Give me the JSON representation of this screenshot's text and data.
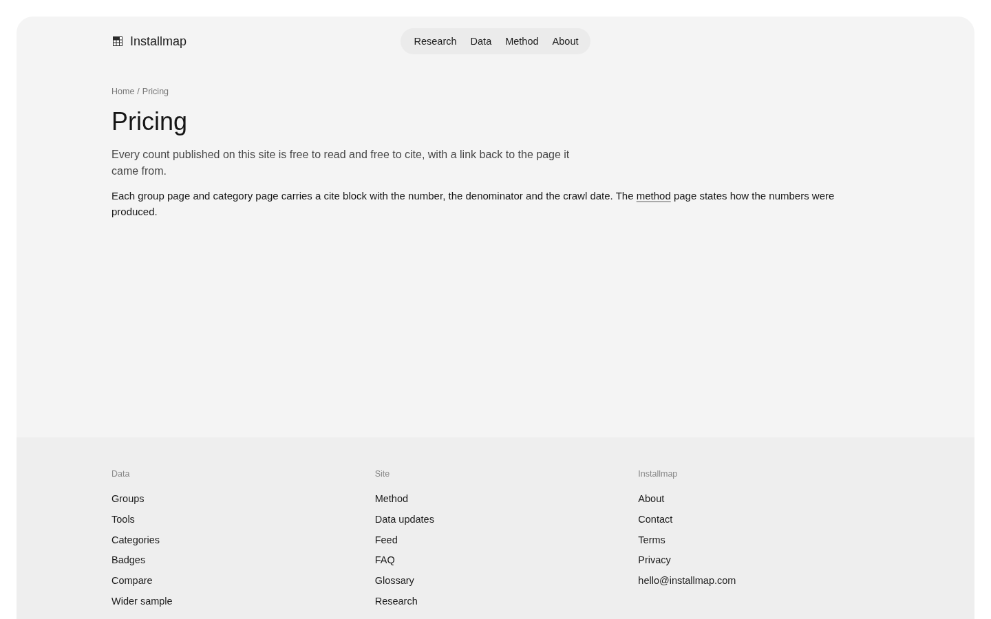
{
  "header": {
    "brand": "Installmap",
    "nav": [
      {
        "label": "Research"
      },
      {
        "label": "Data"
      },
      {
        "label": "Method"
      },
      {
        "label": "About"
      }
    ]
  },
  "breadcrumb": {
    "items": [
      "Home",
      "Pricing"
    ],
    "separator": "/"
  },
  "title": "Pricing",
  "lead": "Every count published on this site is free to read and free to cite, with a link back to the page it came from.",
  "body": [
    {
      "kind": "text",
      "text": "Each group page and category page carries a cite block with the number, the denominator and the crawl date. The "
    },
    {
      "kind": "link",
      "text": "method"
    },
    {
      "kind": "text",
      "text": " page states how the numbers were produced."
    }
  ],
  "footer": {
    "columns": [
      {
        "heading": "Data",
        "links": [
          "Groups",
          "Tools",
          "Categories",
          "Badges",
          "Compare",
          "Wider sample"
        ]
      },
      {
        "heading": "Site",
        "links": [
          "Method",
          "Data updates",
          "Feed",
          "FAQ",
          "Glossary",
          "Research"
        ]
      },
      {
        "heading": "Installmap",
        "links": [
          "About",
          "Contact",
          "Terms",
          "Privacy",
          "hello@installmap.com"
        ]
      }
    ]
  }
}
